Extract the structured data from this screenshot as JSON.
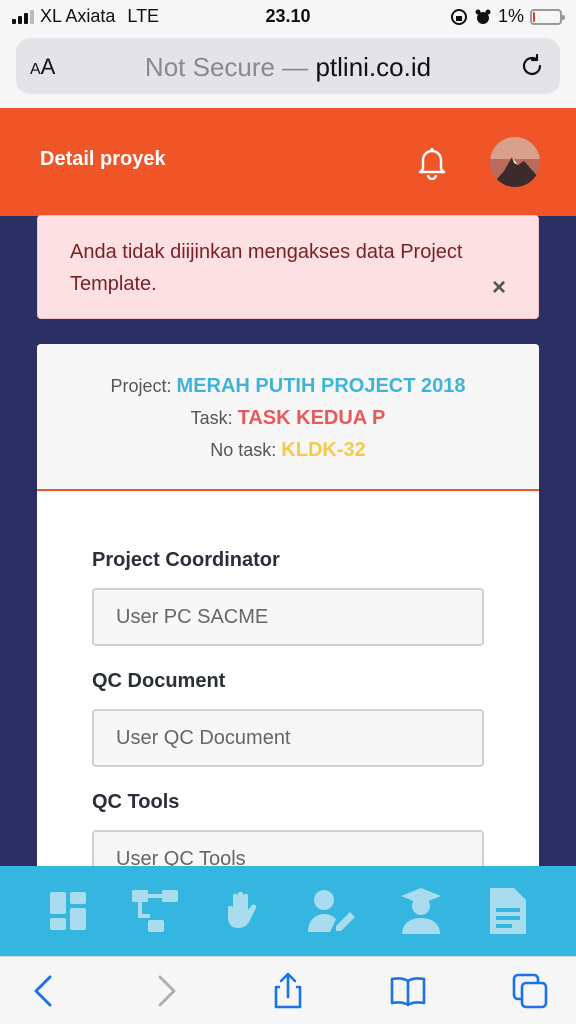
{
  "status": {
    "carrier": "XL Axiata",
    "network": "LTE",
    "time": "23.10",
    "battery": "1%",
    "battery_level": 0.01
  },
  "browser": {
    "aa_small": "A",
    "aa_big": "A",
    "not_secure": "Not Secure —",
    "domain": "ptlini.co.id"
  },
  "header": {
    "title": "Detail proyek"
  },
  "alert": {
    "message": "Anda tidak diijinkan mengakses data Project Template.",
    "close": "×"
  },
  "project_info": {
    "project_label": "Project:",
    "project_value": "MERAH PUTIH PROJECT 2018",
    "task_label": "Task:",
    "task_value": "TASK KEDUA P",
    "no_task_label": "No task:",
    "no_task_value": "KLDK-32"
  },
  "fields": [
    {
      "label": "Project Coordinator",
      "value": "User PC SACME"
    },
    {
      "label": "QC Document",
      "value": "User QC Document"
    },
    {
      "label": "QC Tools",
      "value": "User QC Tools"
    }
  ],
  "colors": {
    "brand": "#f05527",
    "nav": "#35b6e0",
    "background": "#2b2f63"
  }
}
